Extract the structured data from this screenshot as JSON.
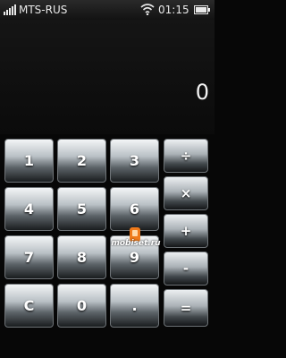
{
  "status": {
    "carrier": "MTS-RUS",
    "time": "01:15",
    "icons": [
      "signal-bars-icon",
      "wifi-icon",
      "battery-icon"
    ]
  },
  "display": {
    "value": "0"
  },
  "keys": {
    "k1": "1",
    "k2": "2",
    "k3": "3",
    "k4": "4",
    "k5": "5",
    "k6": "6",
    "k7": "7",
    "k8": "8",
    "k9": "9",
    "clear": "C",
    "k0": "0",
    "dot": ".",
    "divide": "÷",
    "multiply": "×",
    "plus": "+",
    "minus": "-",
    "equals": "="
  },
  "watermark": {
    "text": "mobiset.ru"
  },
  "colors": {
    "background": "#070707",
    "key_highlight": "#f3f5f6",
    "key_shadow": "#1a1d1f",
    "text": "#ffffff",
    "watermark_orange": "#f07a1a"
  }
}
